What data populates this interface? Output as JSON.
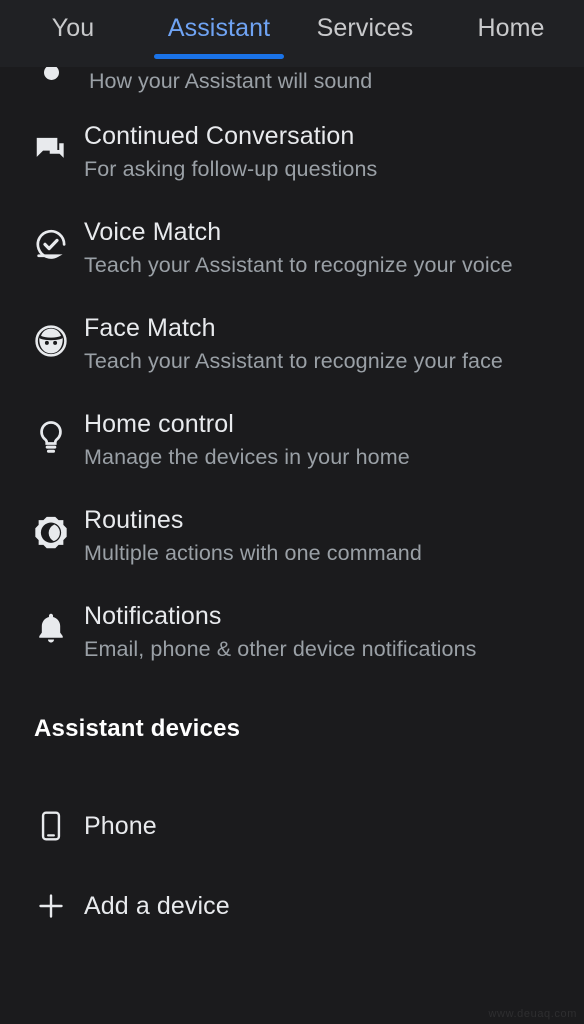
{
  "app": {
    "theme": "dark",
    "background_color": "#1b1b1d",
    "tabbar_background_color": "#202124",
    "accent_color": "#1a73e8",
    "active_tab_text_color": "#6fa3f3",
    "title_text_color": "#e8eaed",
    "subtitle_text_color": "#9aa0a6"
  },
  "tabs": [
    {
      "label": "You",
      "active": false,
      "icon": "tab-you"
    },
    {
      "label": "Assistant",
      "active": true,
      "icon": "tab-assistant"
    },
    {
      "label": "Services",
      "active": false,
      "icon": "tab-services"
    },
    {
      "label": "Home",
      "active": false,
      "icon": "tab-home"
    }
  ],
  "clipped_row": {
    "subtitle": "How your Assistant will sound",
    "icon": "circle-dot-icon"
  },
  "settings_list": [
    {
      "title": "Continued Conversation",
      "subtitle": "For asking follow-up questions",
      "icon": "forum-icon"
    },
    {
      "title": "Voice Match",
      "subtitle": "Teach your Assistant to recognize your voice",
      "icon": "voice-check-icon"
    },
    {
      "title": "Face Match",
      "subtitle": "Teach your Assistant to recognize your face",
      "icon": "face-icon"
    },
    {
      "title": "Home control",
      "subtitle": "Manage the devices in your home",
      "icon": "lightbulb-icon"
    },
    {
      "title": "Routines",
      "subtitle": "Multiple actions with one command",
      "icon": "routines-sun-moon-icon"
    },
    {
      "title": "Notifications",
      "subtitle": "Email, phone & other device notifications",
      "icon": "bell-icon"
    }
  ],
  "devices_section": {
    "header": "Assistant devices",
    "items": [
      {
        "title": "Phone",
        "icon": "smartphone-icon"
      },
      {
        "title": "Add a device",
        "icon": "plus-icon"
      }
    ]
  },
  "watermark": {
    "text": "www.deuaq.com"
  }
}
